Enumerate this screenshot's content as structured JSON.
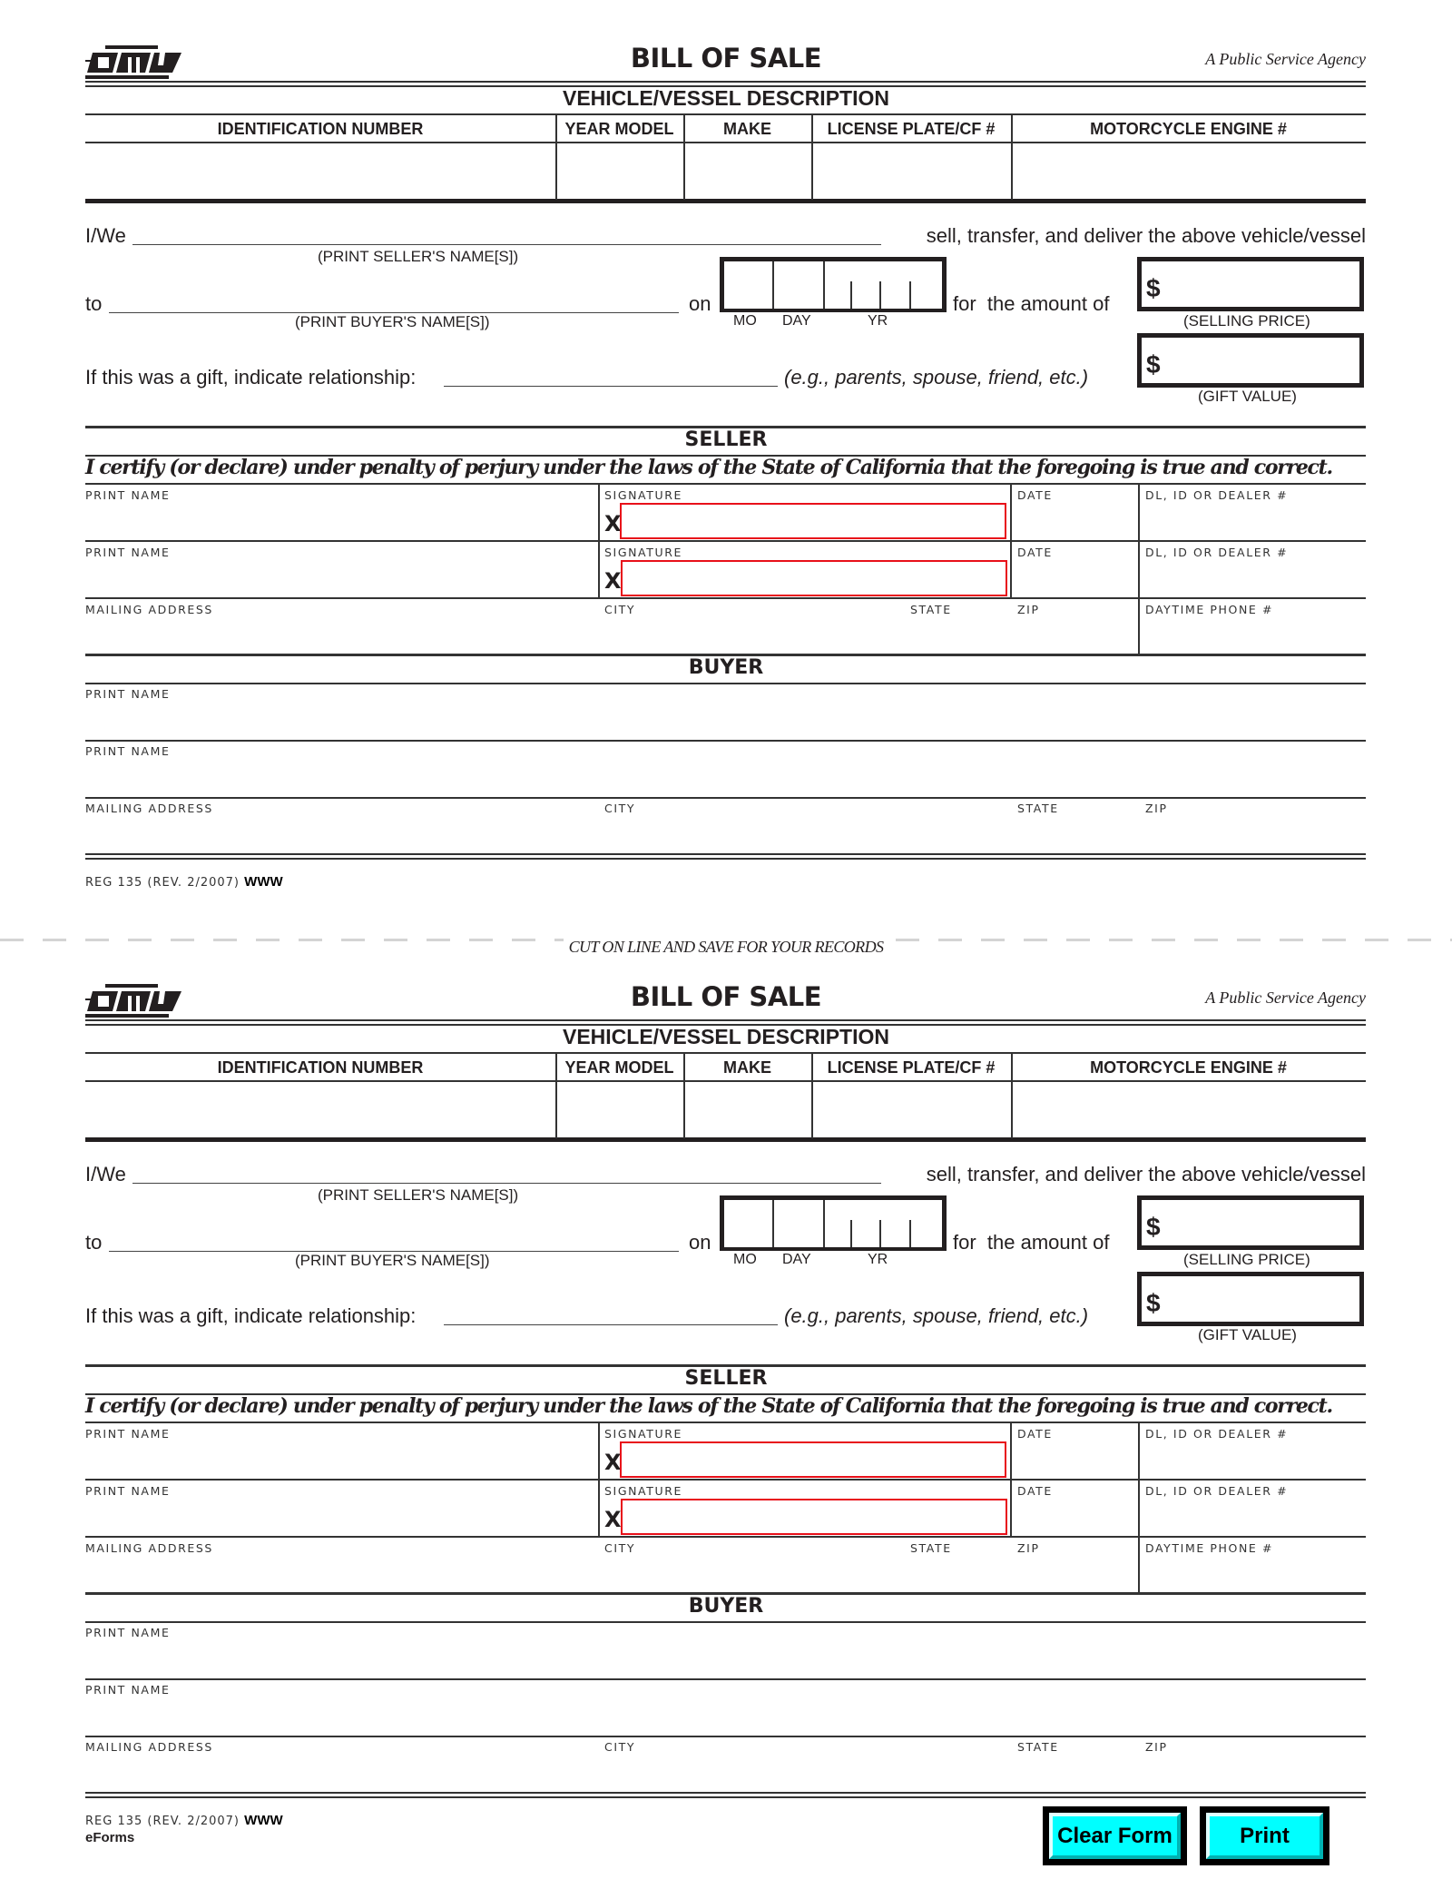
{
  "form": {
    "title": "BILL OF SALE",
    "agency_tagline": "A Public Service Agency",
    "logo_text": "DMV",
    "section_vehicle": "VEHICLE/VESSEL DESCRIPTION",
    "vehicle_columns": [
      "IDENTIFICATION NUMBER",
      "YEAR MODEL",
      "MAKE",
      "LICENSE PLATE/CF #",
      "MOTORCYCLE ENGINE #"
    ],
    "iwe_label": "I/We",
    "transfer_text": "sell, transfer, and deliver the above vehicle/vessel",
    "seller_name_hint": "(PRINT SELLER'S NAME[S])",
    "to_label": "to",
    "buyer_name_hint": "(PRINT BUYER'S NAME[S])",
    "on_label": "on",
    "date_parts": [
      "MO",
      "DAY",
      "YR"
    ],
    "amount_label": "for  the amount of",
    "currency_symbol": "$",
    "selling_price_hint": "(SELLING PRICE)",
    "gift_label": "If this was a gift, indicate relationship:",
    "gift_examples": "(e.g., parents, spouse, friend, etc.)",
    "gift_value_hint": "(GIFT VALUE)",
    "section_seller": "SELLER",
    "certify_text": "I certify (or declare) under penalty of perjury under the laws of the State of California that the foregoing is true and correct.",
    "seller_fields": {
      "print_name": "PRINT NAME",
      "signature": "SIGNATURE",
      "signature_mark": "X",
      "date": "DATE",
      "dl": "DL, ID OR DEALER #",
      "mailing_address": "MAILING ADDRESS",
      "city": "CITY",
      "state": "STATE",
      "zip": "ZIP",
      "phone": "DAYTIME PHONE #"
    },
    "section_buyer": "BUYER",
    "buyer_fields": {
      "print_name": "PRINT NAME",
      "mailing_address": "MAILING ADDRESS",
      "city": "CITY",
      "state": "STATE",
      "zip": "ZIP"
    },
    "form_number": "REG 135 (REV. 2/2007)",
    "form_suffix": "WWW"
  },
  "cut_line_text": "CUT ON LINE AND SAVE FOR YOUR RECORDS",
  "footer": {
    "eforms_label": "eForms",
    "clear_button": "Clear Form",
    "print_button": "Print"
  },
  "colors": {
    "button_fill": "#00ffff",
    "signature_box": "#e8101a",
    "cut_line": "#d4d4d4"
  }
}
